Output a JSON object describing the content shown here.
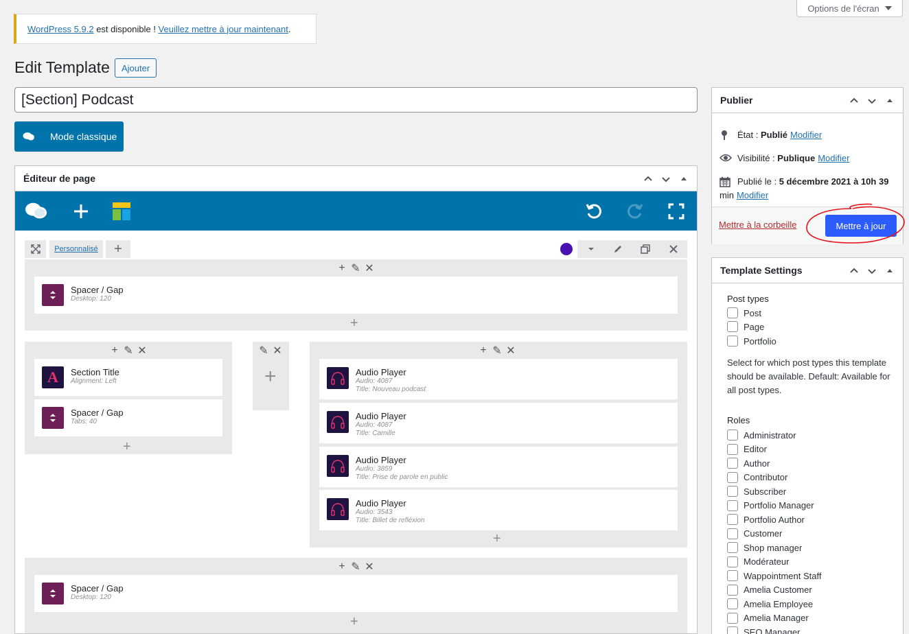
{
  "screen_options": {
    "label": "Options de l'écran"
  },
  "notice": {
    "link1": "WordPress 5.9.2",
    "text": " est disponible ! ",
    "link2": "Veuillez mettre à jour maintenant",
    "end": "."
  },
  "header": {
    "title": "Edit Template",
    "add_label": "Ajouter"
  },
  "title_input": {
    "value": "[Section] Podcast"
  },
  "mode_button": {
    "label": "Mode classique"
  },
  "editor": {
    "box_title": "Éditeur de page",
    "row_custom_label": "Personnalisé",
    "row_color": "#4b12b3",
    "rows": [
      {
        "widgets": [
          {
            "title": "Spacer / Gap",
            "sub": "Desktop: 120",
            "sub2": "",
            "icon": "spacer-icon"
          }
        ]
      },
      {
        "col1": [
          {
            "title": "Section Title",
            "sub": "Alignment: Left",
            "icon": "section-title-icon"
          },
          {
            "title": "Spacer / Gap",
            "sub": "Tabs: 40",
            "icon": "spacer-icon"
          }
        ],
        "col3": [
          {
            "title": "Audio Player",
            "sub": "Audio: 4087",
            "sub2": "Title: Nouveau podcast",
            "icon": "headphones-icon"
          },
          {
            "title": "Audio Player",
            "sub": "Audio: 4087",
            "sub2": "Title: Camille",
            "icon": "headphones-icon"
          },
          {
            "title": "Audio Player",
            "sub": "Audio: 3859",
            "sub2": "Title: Prise de parole en public",
            "icon": "headphones-icon"
          },
          {
            "title": "Audio Player",
            "sub": "Audio: 3543",
            "sub2": "Title: Billet de refléxion",
            "icon": "headphones-icon"
          }
        ]
      },
      {
        "widgets": [
          {
            "title": "Spacer / Gap",
            "sub": "Desktop: 120",
            "icon": "spacer-icon"
          }
        ]
      }
    ]
  },
  "publish": {
    "title": "Publier",
    "status_label": "État : ",
    "status_value": "Publié",
    "status_link": "Modifier",
    "visibility_label": "Visibilité : ",
    "visibility_value": "Publique",
    "visibility_link": "Modifier",
    "published_label": "Publié le : ",
    "published_value": "5 décembre 2021 à 10h 39",
    "published_min": "min",
    "published_link": "Modifier",
    "trash_label": "Mettre à la corbeille",
    "update_label": "Mettre à jour"
  },
  "settings": {
    "title": "Template Settings",
    "post_types_label": "Post types",
    "post_types": [
      "Post",
      "Page",
      "Portfolio"
    ],
    "help": "Select for which post types this template should be available. Default: Available for all post types.",
    "roles_label": "Roles",
    "roles": [
      "Administrator",
      "Editor",
      "Author",
      "Contributor",
      "Subscriber",
      "Portfolio Manager",
      "Portfolio Author",
      "Customer",
      "Shop manager",
      "Modérateur",
      "Wappointment Staff",
      "Amelia Customer",
      "Amelia Employee",
      "Amelia Manager",
      "SEO Manager"
    ]
  }
}
